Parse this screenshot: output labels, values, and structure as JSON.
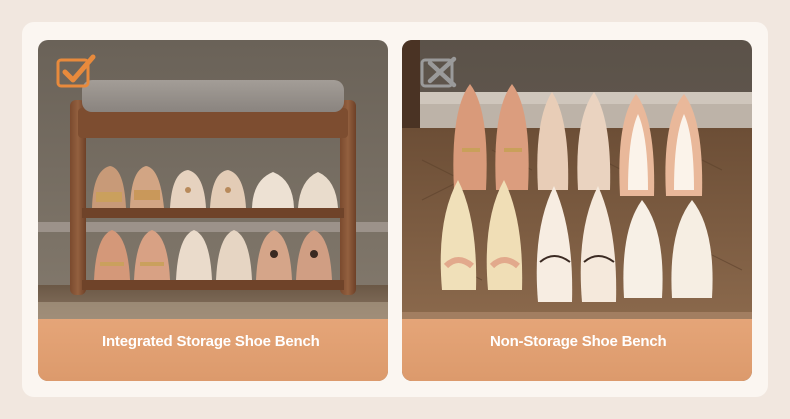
{
  "panels": {
    "integrated": {
      "caption": "Integrated Storage Shoe Bench",
      "badge_icon": "checkmark-icon",
      "accent": "#e88a3c"
    },
    "non_storage": {
      "caption": "Non-Storage Shoe Bench",
      "badge_icon": "cross-icon",
      "accent": "#9a9a9a"
    }
  },
  "colors": {
    "background": "#f1e7df",
    "caption_band": "#dd9b6d",
    "caption_text": "#ffffff"
  }
}
